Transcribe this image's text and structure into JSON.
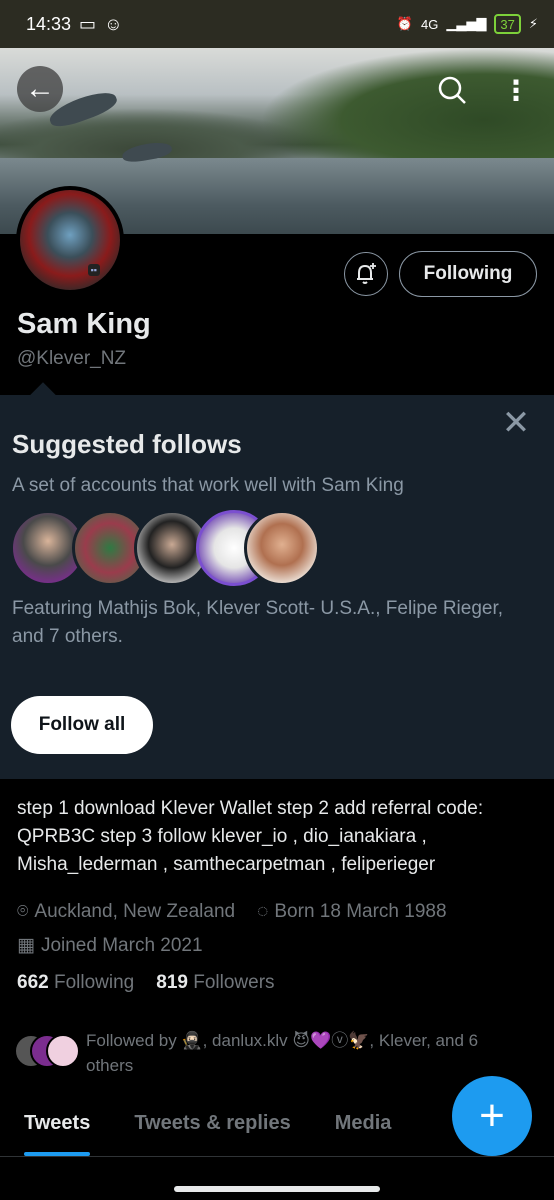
{
  "status_bar": {
    "time": "14:33",
    "network": "4G",
    "battery": "37"
  },
  "header": {
    "back_icon": "arrow-left-icon",
    "search_icon": "search-icon",
    "more_icon": "more-vertical-icon"
  },
  "profile": {
    "name": "Sam King",
    "handle": "@Klever_NZ",
    "follow_button_label": "Following",
    "bio": "step 1 download Klever Wallet step 2 add referral code: QPRB3C step 3 follow klever_io , dio_ianakiara , Misha_lederman , samthecarpetman , feliperieger",
    "location": "Auckland, New Zealand",
    "birthday": "Born 18 March 1988",
    "joined": "Joined March 2021",
    "following_count": "662",
    "following_label": "Following",
    "followers_count": "819",
    "followers_label": "Followers",
    "followed_by": "Followed by 🥷🏻, danlux.klv 😈💜ⓥ🦅, Klever, and 6 others"
  },
  "suggested": {
    "title": "Suggested follows",
    "subtitle": "A set of accounts that work well with Sam King",
    "featuring": "Featuring Mathijs Bok, Klever Scott- U.S.A., Felipe Rieger, and 7 others.",
    "follow_all_label": "Follow all"
  },
  "tabs": [
    {
      "label": "Tweets",
      "active": true
    },
    {
      "label": "Tweets & replies",
      "active": false
    },
    {
      "label": "Media",
      "active": false
    }
  ],
  "colors": {
    "accent": "#1d9bf0",
    "panel": "#16202a"
  }
}
